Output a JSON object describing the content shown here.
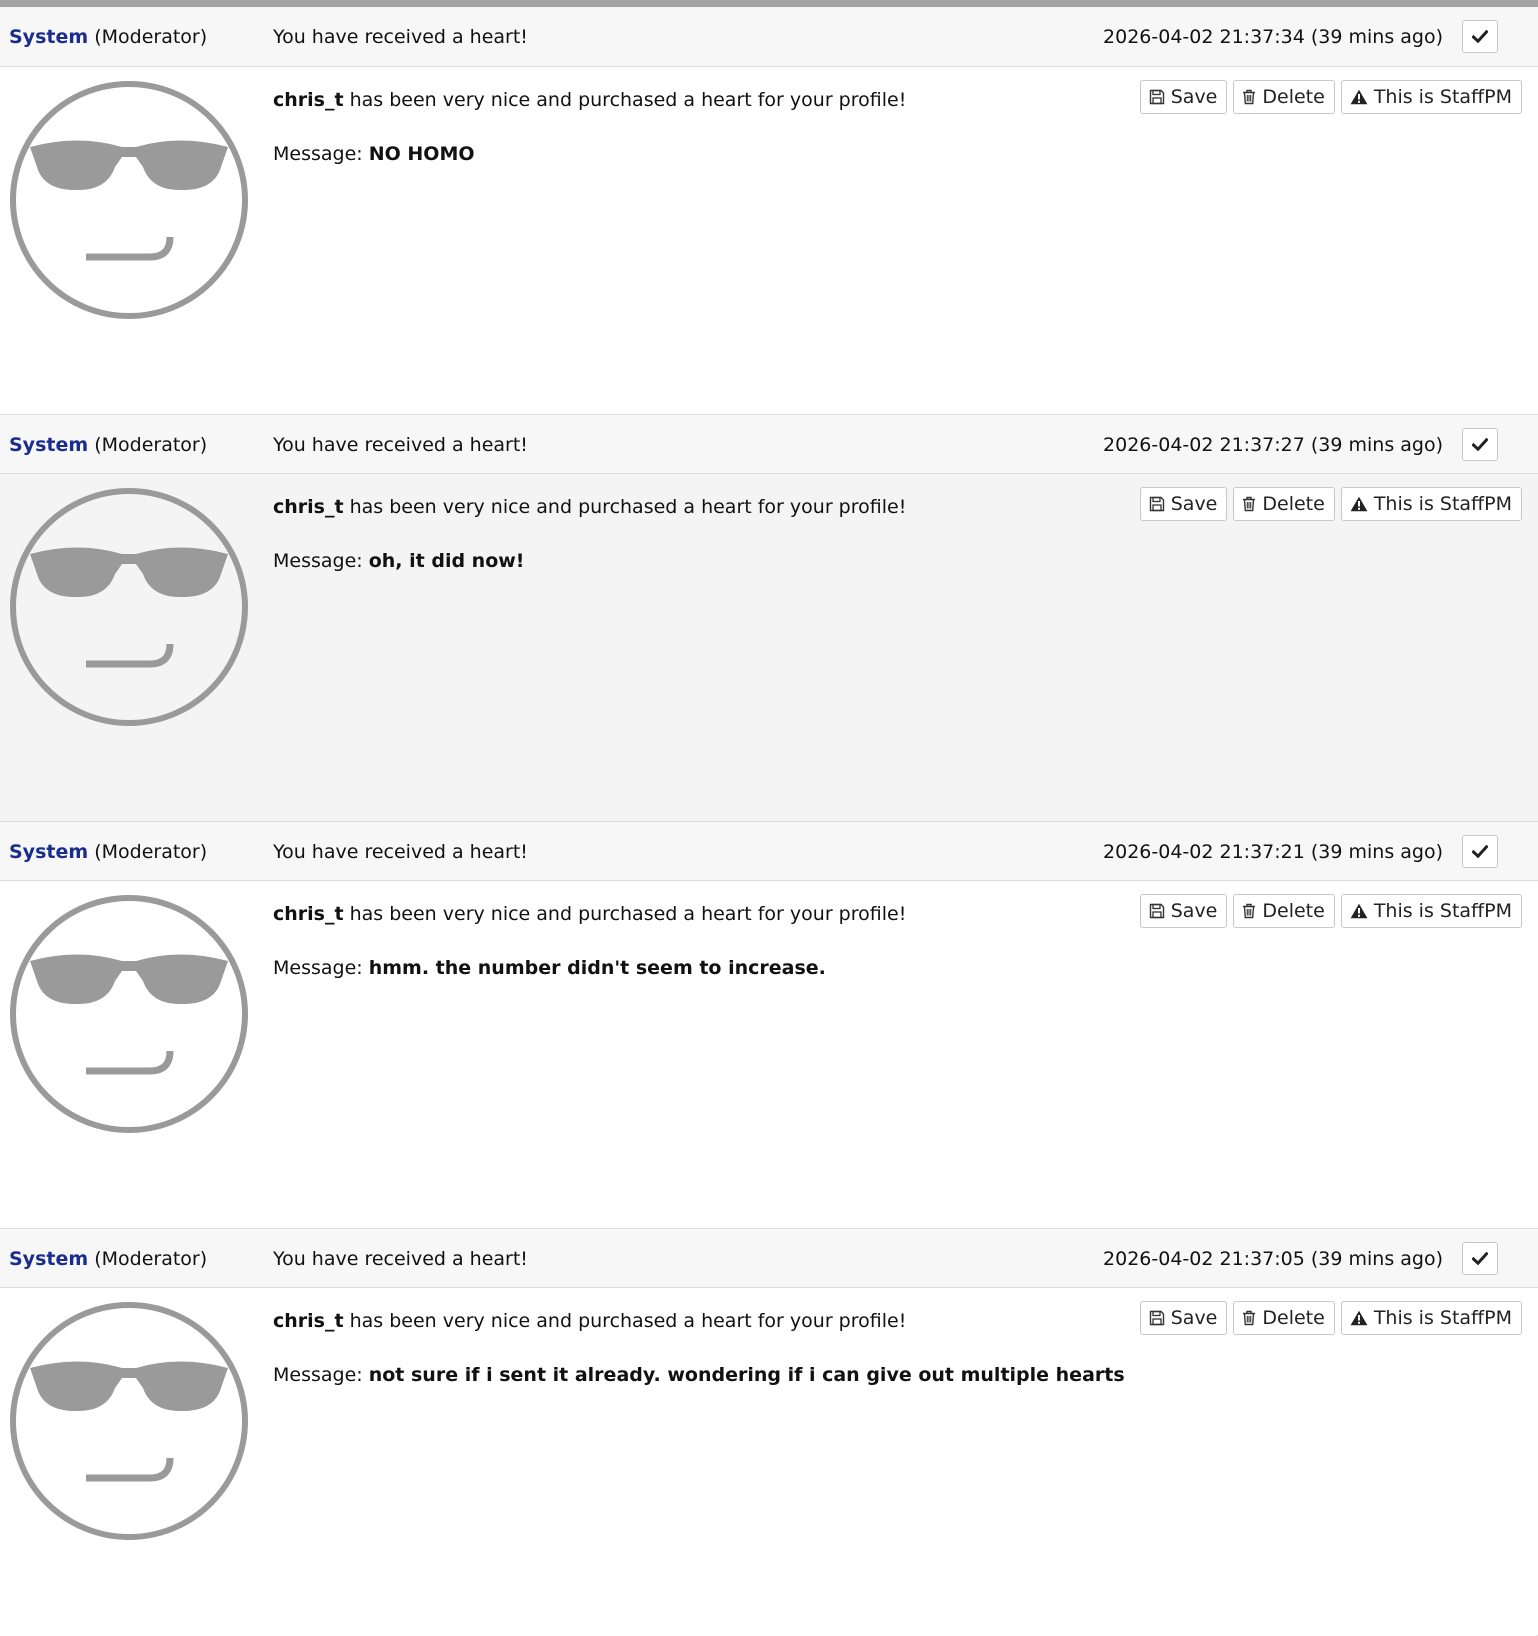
{
  "messages": [
    {
      "sender": "System",
      "role": "(Moderator)",
      "subject": "You have received a heart!",
      "timestamp": "2026-04-02 21:37:34 (39 mins ago)",
      "author": "chris_t",
      "body": " has been very nice and purchased a heart for your profile!",
      "message_label": "Message: ",
      "message": "NO HOMO"
    },
    {
      "sender": "System",
      "role": "(Moderator)",
      "subject": "You have received a heart!",
      "timestamp": "2026-04-02 21:37:27 (39 mins ago)",
      "author": "chris_t",
      "body": " has been very nice and purchased a heart for your profile!",
      "message_label": "Message: ",
      "message": "oh, it did now!"
    },
    {
      "sender": "System",
      "role": "(Moderator)",
      "subject": "You have received a heart!",
      "timestamp": "2026-04-02 21:37:21 (39 mins ago)",
      "author": "chris_t",
      "body": " has been very nice and purchased a heart for your profile!",
      "message_label": "Message: ",
      "message": "hmm. the number didn't seem to increase."
    },
    {
      "sender": "System",
      "role": "(Moderator)",
      "subject": "You have received a heart!",
      "timestamp": "2026-04-02 21:37:05 (39 mins ago)",
      "author": "chris_t",
      "body": " has been very nice and purchased a heart for your profile!",
      "message_label": "Message: ",
      "message": "not sure if i sent it already. wondering if i can give out multiple hearts"
    }
  ],
  "actions": {
    "save_label": "Save",
    "delete_label": "Delete",
    "staffpm_label": "This is StaffPM"
  },
  "icons": {
    "check": "check-icon",
    "save": "floppy-disk-icon",
    "delete": "trash-icon",
    "staffpm": "warning-triangle-icon",
    "avatar": "sunglasses-smiley-icon"
  },
  "colors": {
    "sender_link": "#1a2d8f",
    "header_bg": "#f7f7f7",
    "alt_body_bg": "#f4f4f4",
    "avatar_gray": "#9a9a9a",
    "top_bar": "#a3a3a3"
  }
}
